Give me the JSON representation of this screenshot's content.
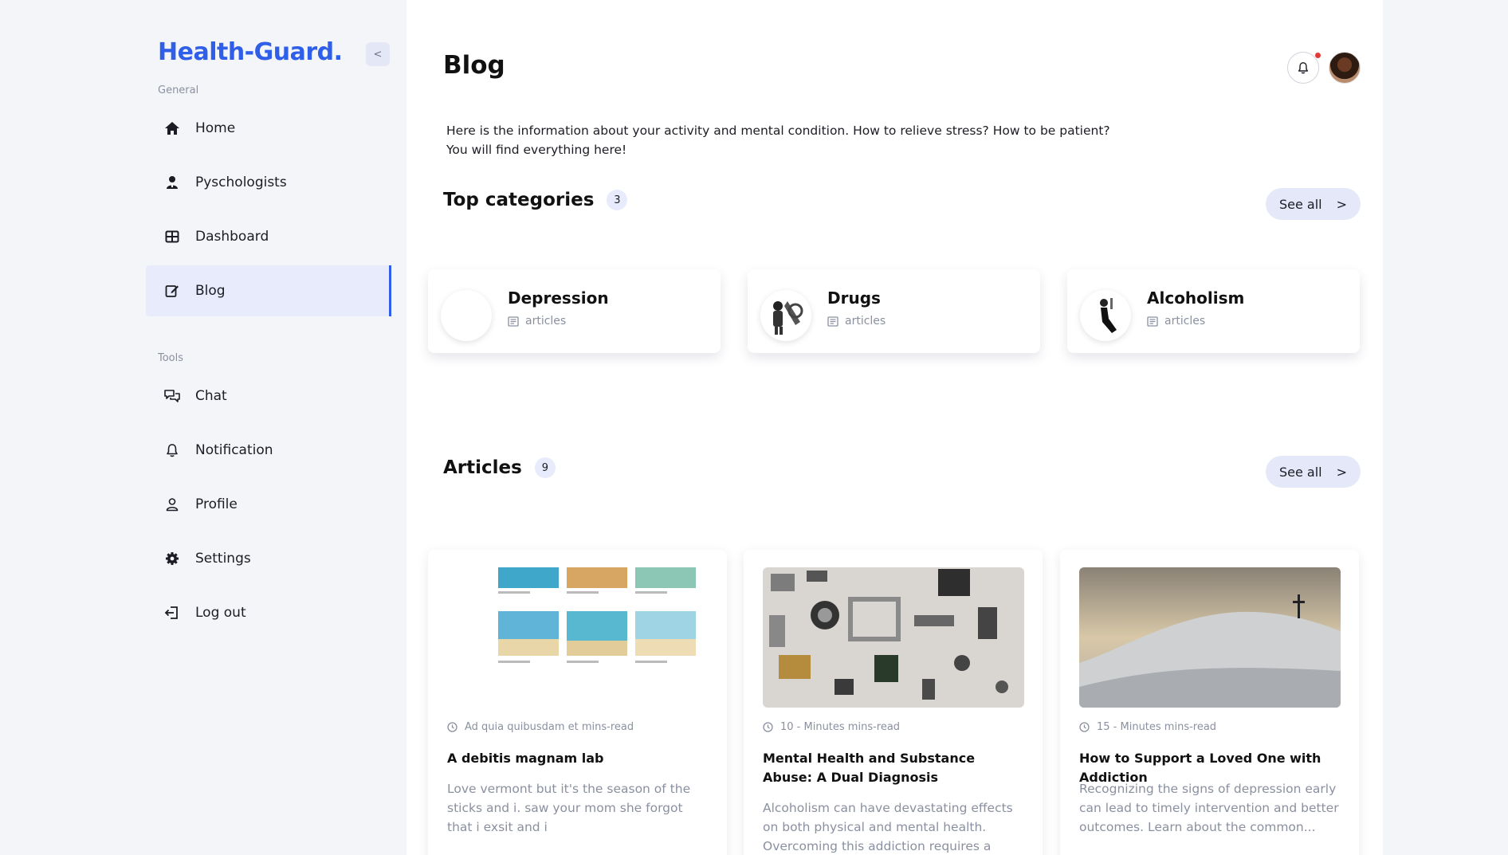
{
  "app": {
    "logo": "Health-Guard.",
    "collapse_label": "<"
  },
  "sidebar": {
    "general_label": "General",
    "tools_label": "Tools",
    "items": [
      {
        "label": "Home",
        "icon": "home-icon"
      },
      {
        "label": "Pyschologists",
        "icon": "psychologist-icon"
      },
      {
        "label": "Dashboard",
        "icon": "dashboard-icon"
      },
      {
        "label": "Blog",
        "icon": "edit-icon",
        "active": true
      },
      {
        "label": "Chat",
        "icon": "chat-icon"
      },
      {
        "label": "Notification",
        "icon": "bell-icon"
      },
      {
        "label": "Profile",
        "icon": "user-icon"
      },
      {
        "label": "Settings",
        "icon": "gear-icon"
      },
      {
        "label": "Log out",
        "icon": "logout-icon"
      }
    ]
  },
  "header": {
    "title": "Blog"
  },
  "intro": "Here is the information about your activity and mental condition. How to relieve stress? How to be patient? You will find everything here!",
  "categories": {
    "title": "Top categories",
    "count": "3",
    "see_all": "See all",
    "see_all_arrow": ">",
    "items": [
      {
        "name": "Depression",
        "sub": "articles"
      },
      {
        "name": "Drugs",
        "sub": "articles"
      },
      {
        "name": "Alcoholism",
        "sub": "articles"
      }
    ]
  },
  "articles": {
    "title": "Articles",
    "count": "9",
    "see_all": "See all",
    "see_all_arrow": ">",
    "items": [
      {
        "meta": "Ad quia quibusdam et mins-read",
        "title": "A debitis magnam lab",
        "desc": "Love vermont but it's the season of the sticks and i. saw your mom she forgot that i exsit and i"
      },
      {
        "meta": "10 - Minutes mins-read",
        "title": "Mental Health and Substance Abuse: A Dual Diagnosis",
        "desc": "Alcoholism can have devastating effects on both physical and mental health. Overcoming this addiction requires a comprehensive..."
      },
      {
        "meta": "15 - Minutes mins-read",
        "title": "How to Support a Loved One with Addiction",
        "desc": "Recognizing the signs of depression early can lead to timely intervention and better outcomes. Learn about the common..."
      }
    ]
  },
  "colors": {
    "accent": "#2f5ee8",
    "active_bg": "#e7ebfb",
    "muted": "#8a90a0",
    "notification_dot": "#e53935"
  }
}
